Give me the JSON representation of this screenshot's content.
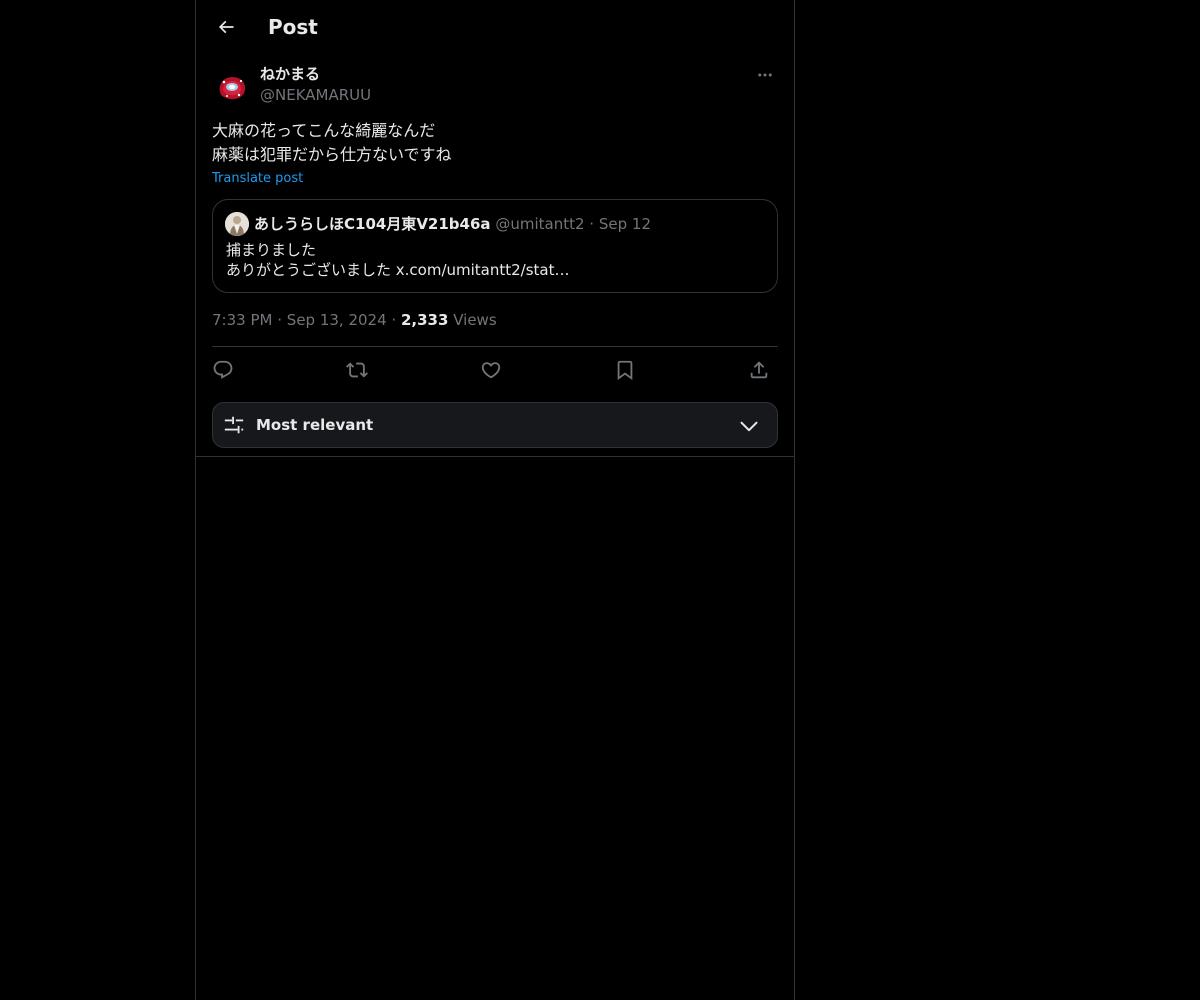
{
  "header": {
    "title": "Post",
    "back_icon": "arrow-left-icon"
  },
  "post": {
    "author": {
      "name": "ねかまる",
      "handle": "@NEKAMARUU"
    },
    "text_lines": [
      "大麻の花ってこんな綺麗なんだ",
      "麻薬は犯罪だから仕方ないですね"
    ],
    "translate_label": "Translate post",
    "quote": {
      "name": "あしうらしほC104月東V21b46a",
      "handle": "@umitantt2",
      "separator": "·",
      "date": "Sep 12",
      "text_lines": [
        "捕まりました",
        "ありがとうございました x.com/umitantt2/stat…"
      ]
    },
    "meta": {
      "time": "7:33 PM",
      "separator": "·",
      "date": "Sep 13, 2024",
      "views_count": "2,333",
      "views_label": "Views"
    },
    "actions": [
      "reply-icon",
      "repost-icon",
      "like-icon",
      "bookmark-icon",
      "share-icon"
    ]
  },
  "replies_sort": {
    "label": "Most relevant",
    "icon": "sliders-icon",
    "chevron": "chevron-down-icon"
  },
  "colors": {
    "background": "#000000",
    "text": "#e7e9ea",
    "secondary": "#71767b",
    "link": "#1d9bf0",
    "border": "#2f3336",
    "card": "#16181c"
  }
}
